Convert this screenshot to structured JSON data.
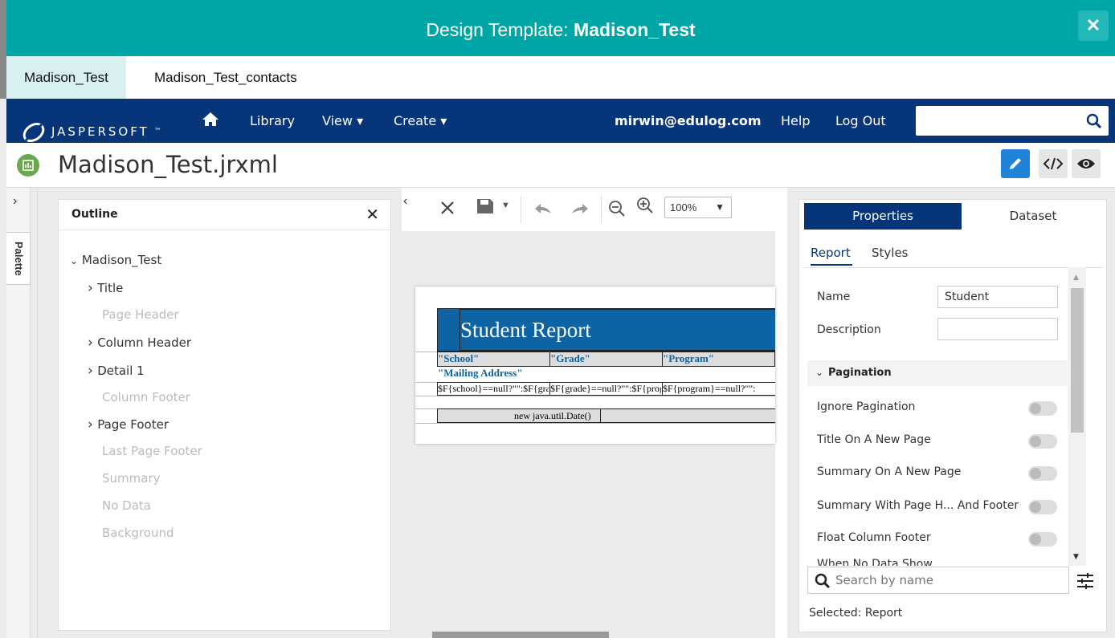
{
  "dialog": {
    "title_prefix": "Design Template:",
    "title_name": "Madison_Test",
    "close_glyph": "✕"
  },
  "tabs": [
    {
      "label": "Madison_Test"
    },
    {
      "label": "Madison_Test_contacts"
    }
  ],
  "nav": {
    "brand": "JASPERSOFT",
    "brand_tm": "™",
    "library": "Library",
    "view": "View",
    "create": "Create",
    "user": "mirwin@edulog.com",
    "help": "Help",
    "logout": "Log Out",
    "search_value": ""
  },
  "file": {
    "name": "Madison_Test.jrxml"
  },
  "palette": {
    "label": "Palette"
  },
  "outline": {
    "title": "Outline",
    "root": "Madison_Test",
    "items": [
      {
        "label": "Title",
        "expandable": true
      },
      {
        "label": "Page Header",
        "expandable": false
      },
      {
        "label": "Column Header",
        "expandable": true
      },
      {
        "label": "Detail 1",
        "expandable": true
      },
      {
        "label": "Column Footer",
        "expandable": false
      },
      {
        "label": "Page Footer",
        "expandable": true
      },
      {
        "label": "Last Page Footer",
        "expandable": false
      },
      {
        "label": "Summary",
        "expandable": false
      },
      {
        "label": "No Data",
        "expandable": false
      },
      {
        "label": "Background",
        "expandable": false
      }
    ]
  },
  "canvas": {
    "zoom": "100%",
    "report_title": "Student Report",
    "headers": [
      "\"School\"",
      "\"Grade\"",
      "\"Program\""
    ],
    "header2": "\"Mailing Address\"",
    "detail": [
      "$F{school}==null?\"\":$F{grade}==null?\"\":$F{program}==null?\"\":",
      "$F{grade}==null?\"\":$F{program}==null?\"\":",
      "$F{program}==null?\"\":"
    ],
    "footer": "new java.util.Date()"
  },
  "properties": {
    "tabs": [
      "Properties",
      "Dataset"
    ],
    "subtabs": [
      "Report",
      "Styles"
    ],
    "name_label": "Name",
    "name_value": "Student",
    "description_label": "Description",
    "description_value": "",
    "section": "Pagination",
    "toggles": [
      {
        "label": "Ignore Pagination",
        "on": false
      },
      {
        "label": "Title On A New Page",
        "on": false
      },
      {
        "label": "Summary On A New Page",
        "on": false
      },
      {
        "label": "Summary With Page H... And Footer",
        "on": false
      },
      {
        "label": "Float Column Footer",
        "on": false
      }
    ],
    "cutoff_label": "When No Data Show...",
    "search_placeholder": "Search by name",
    "selected_label": "Selected:",
    "selected_value": "Report"
  },
  "colors": {
    "teal": "#00a6a6",
    "navy": "#073579",
    "accent": "#1f84d8",
    "report_band": "#0e63a3"
  }
}
